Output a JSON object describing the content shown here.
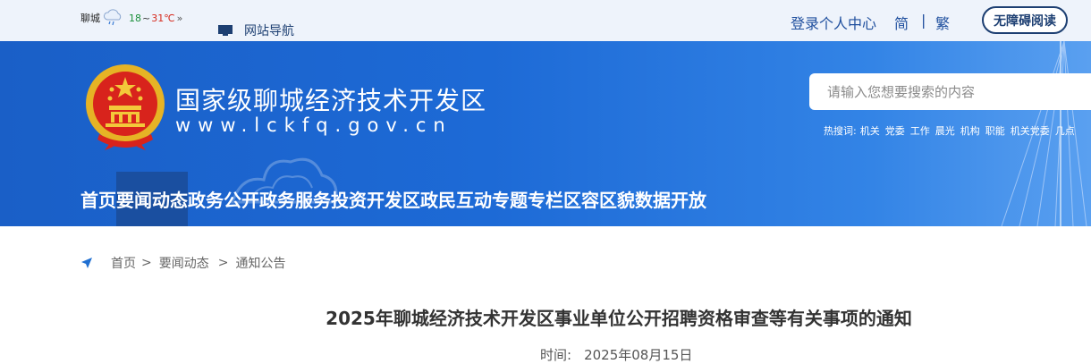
{
  "topbar": {
    "weather_city": "聊城",
    "temp_low": "18",
    "temp_sep": "~",
    "temp_high": "31℃",
    "weather_more": "»",
    "site_nav": "网站导航",
    "login": "登录个人中心",
    "simplified": "简",
    "divider": "|",
    "traditional": "繁",
    "accessibility": "无障碍阅读"
  },
  "header": {
    "site_name": "国家级聊城经济技术开发区",
    "site_url": "www.lckfq.gov.cn",
    "search_placeholder": "请输入您想要搜索的内容",
    "hot_label": "热搜词:",
    "hot_words": [
      "机关",
      "党委",
      "工作",
      "晨光",
      "机构",
      "职能",
      "机关党委",
      "几点"
    ],
    "nav": [
      "首页",
      "要闻动态",
      "政务公开",
      "政务服务",
      "投资开发区",
      "政民互动",
      "专题专栏",
      "区容区貌",
      "数据开放"
    ]
  },
  "breadcrumb": [
    "首页",
    "要闻动态",
    "通知公告"
  ],
  "breadcrumb_sep": ">",
  "article": {
    "title": "2025年聊城经济技术开发区事业单位公开招聘资格审查等有关事项的通知",
    "time_label": "时间:",
    "time_value": "2025年08月15日"
  },
  "colors": {
    "header_blue": "#1d6ad6",
    "nav_active": "#1a4fa0",
    "link_blue": "#1f4f9e"
  }
}
